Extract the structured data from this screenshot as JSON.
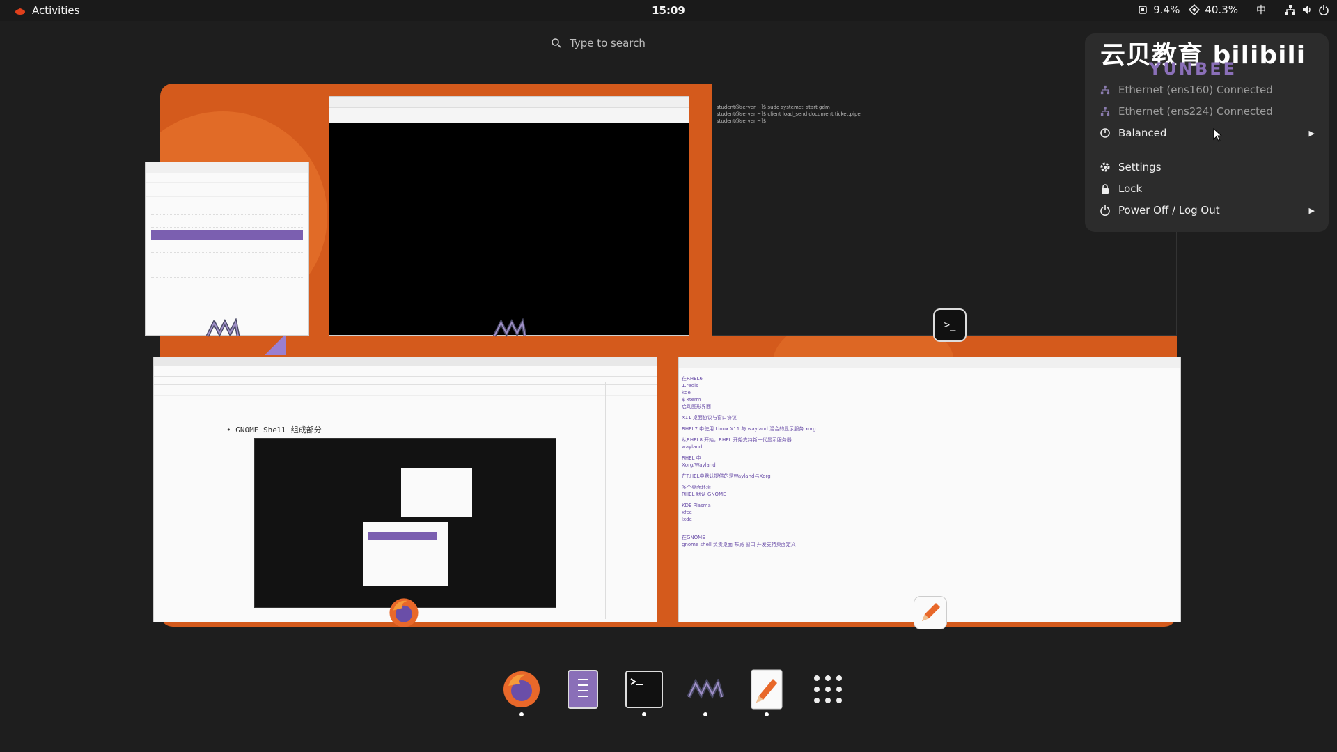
{
  "topbar": {
    "activities_label": "Activities",
    "clock": "15:09",
    "cpu": "9.4%",
    "mem": "40.3%",
    "ime": "中"
  },
  "search": {
    "placeholder": "Type to search"
  },
  "watermark": {
    "brand": "云贝教育 bilibili",
    "sub": "YUNBEE"
  },
  "system_menu": {
    "items": [
      {
        "label": "Ethernet (ens160) Connected",
        "icon": "network-wired-icon"
      },
      {
        "label": "Ethernet (ens224) Connected",
        "icon": "network-wired-icon"
      },
      {
        "label": "Balanced",
        "icon": "power-profile-icon"
      },
      {
        "label": "Settings",
        "icon": "gear-icon"
      },
      {
        "label": "Lock",
        "icon": "lock-icon"
      },
      {
        "label": "Power Off / Log Out",
        "icon": "power-icon"
      }
    ]
  },
  "windows": {
    "browser_slide_title": "GNOME Shell 组成部分",
    "editor_lines": [
      "在RHEL6",
      "1.redis",
      "kde",
      "$ xterm",
      "启动图形界面",
      "X11 桌面协议与窗口协议",
      "RHEL7 中使用 Linux X11 与 wayland 混合的显示服务 xorg",
      "从RHEL8 开始，RHEL 开始支持新一代显示服务器",
      "wayland",
      "RHEL 中",
      "Xorg/Wayland",
      "在RHEL中默认提供的是Wayland与Xorg",
      "多个桌面环境",
      "RHEL 默认 GNOME",
      "KDE Plasma",
      "xfce",
      "lxde",
      "在GNOME",
      "gnome shell 负责桌面 布局 窗口 开发支持桌面定义"
    ]
  },
  "dash": {
    "items": [
      {
        "name": "firefox",
        "running": true
      },
      {
        "name": "files",
        "running": false
      },
      {
        "name": "terminal",
        "running": true
      },
      {
        "name": "virt-manager",
        "running": true
      },
      {
        "name": "text-editor",
        "running": true
      },
      {
        "name": "app-grid",
        "running": false
      }
    ]
  },
  "colors": {
    "accent": "#d45a1c",
    "purple": "#7b5fb0",
    "panel": "#1a1a1a",
    "menu_bg": "#2c2c2c"
  }
}
